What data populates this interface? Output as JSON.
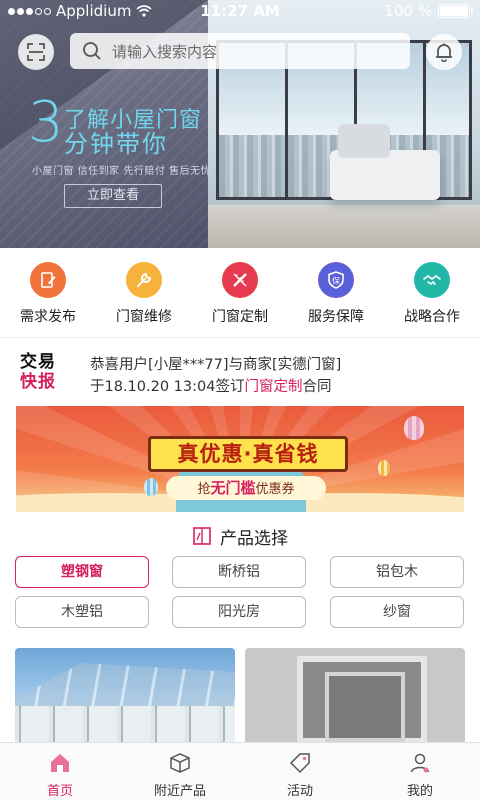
{
  "status_bar": {
    "carrier": "Applidium",
    "time": "11:27 AM",
    "battery": "100 %"
  },
  "header": {
    "search_placeholder": "请输入搜索内容"
  },
  "banner": {
    "big_number": "3",
    "line1": "了解小屋门窗",
    "line2": "分钟带你",
    "subtitle": "小屋门窗 信任到家 先行赔付 售后无忧",
    "button": "立即查看"
  },
  "categories": [
    {
      "label": "需求发布",
      "icon": "document-edit-icon",
      "color": "#f0733a"
    },
    {
      "label": "门窗维修",
      "icon": "wrench-icon",
      "color": "#f6b23a"
    },
    {
      "label": "门窗定制",
      "icon": "ruler-pencil-icon",
      "color": "#e83a4e"
    },
    {
      "label": "服务保障",
      "icon": "shield-icon",
      "color": "#5b5fd8"
    },
    {
      "label": "战略合作",
      "icon": "handshake-icon",
      "color": "#22b6a6"
    }
  ],
  "news": {
    "logo_top": "交易",
    "logo_bottom": "快报",
    "line1": "恭喜用户[小屋***77]与商家[实德门窗]",
    "line2_pre": "于18.10.20 13:04签订",
    "line2_highlight": "门窗定制",
    "line2_post": "合同"
  },
  "coupon": {
    "title": "真优惠·真省钱",
    "sub_pre": "抢",
    "sub_em": "无门槛",
    "sub_post": "优惠券"
  },
  "product_select": {
    "title": "产品选择",
    "chips": [
      "塑钢窗",
      "断桥铝",
      "铝包木",
      "木塑铝",
      "阳光房",
      "纱窗"
    ],
    "active_index": 0
  },
  "tabs": [
    {
      "label": "首页",
      "icon": "home-icon"
    },
    {
      "label": "附近产品",
      "icon": "box-icon"
    },
    {
      "label": "活动",
      "icon": "tag-icon"
    },
    {
      "label": "我的",
      "icon": "user-icon"
    }
  ],
  "accent_color": "#d7205e"
}
